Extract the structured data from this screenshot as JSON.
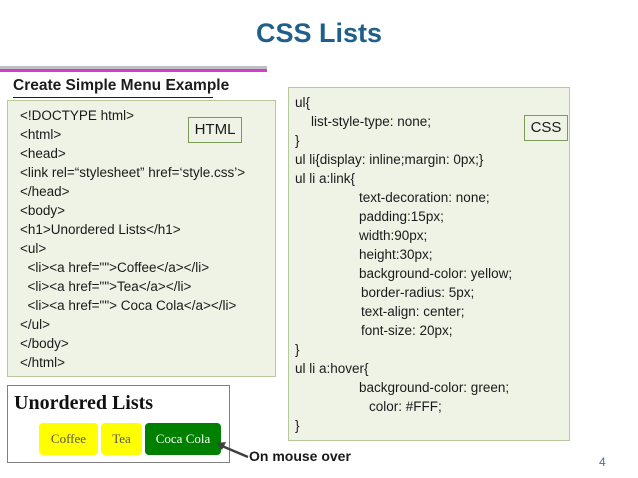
{
  "slide": {
    "title": "CSS Lists",
    "subtitle": "Create Simple Menu Example",
    "html_tag": "HTML",
    "css_tag": "CSS",
    "annotation": "On mouse over",
    "page_number": "4"
  },
  "html_code": [
    "<!DOCTYPE html>",
    "<html>",
    "<head>",
    "<link rel=“stylesheet” href=‘style.css’>",
    "</head>",
    "<body>",
    "<h1>Unordered Lists</h1>",
    "<ul>",
    "  <li><a href=\"\">Coffee</a></li>",
    "  <li><a href=\"\">Tea</a></li>",
    "  <li><a href=\"\"> Coca Cola</a></li>",
    "</ul>",
    "</body>",
    "</html>"
  ],
  "css_code": [
    "ul{",
    "list-style-type: none;",
    "}",
    "ul li{display: inline;margin: 0px;}",
    "ul li a:link{",
    "text-decoration: none;",
    "padding:15px;",
    "width:90px;",
    "height:30px;",
    "background-color: yellow;",
    "border-radius: 5px;",
    "text-align: center;",
    "font-size: 20px;",
    "}",
    "ul li a:hover{",
    "background-color: green;",
    "color: #FFF;",
    "}"
  ],
  "demo": {
    "heading": "Unordered Lists",
    "items": [
      "Coffee",
      "Tea",
      "Coca Cola"
    ],
    "hovered_item": "Coca Cola"
  }
}
